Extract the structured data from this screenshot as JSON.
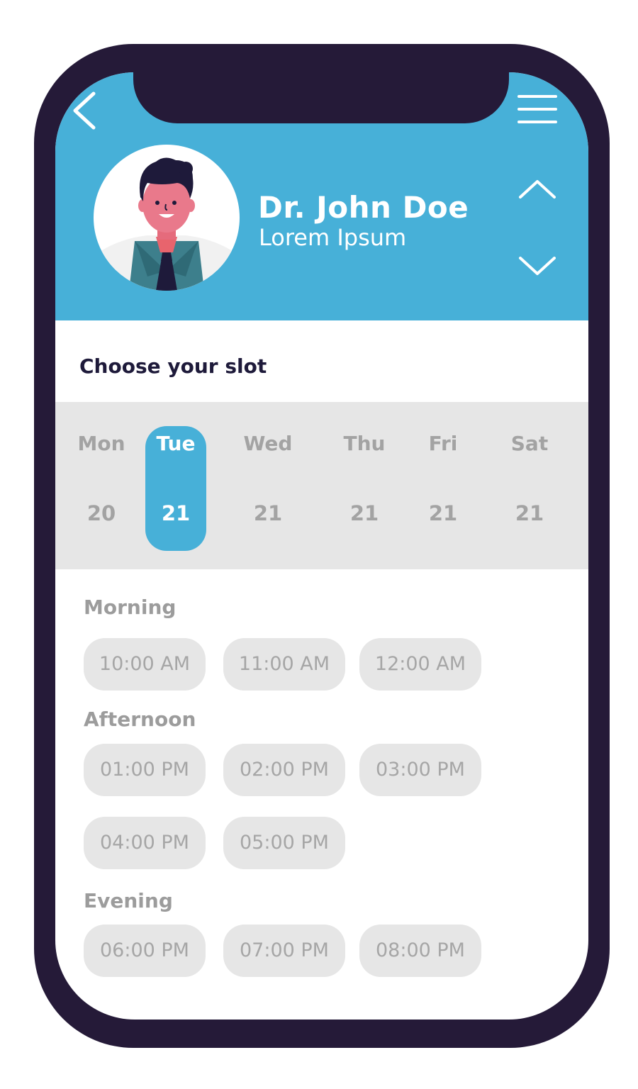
{
  "header": {
    "doctor_name": "Dr. John Doe",
    "doctor_subtitle": "Lorem Ipsum",
    "back_icon": "chevron-left-icon",
    "menu_icon": "hamburger-menu-icon",
    "up_icon": "chevron-up-icon",
    "down_icon": "chevron-down-icon",
    "color": "#47b0d8"
  },
  "slot_picker": {
    "title": "Choose your slot",
    "days": [
      {
        "name": "Mon",
        "date": "20",
        "selected": false
      },
      {
        "name": "Tue",
        "date": "21",
        "selected": true
      },
      {
        "name": "Wed",
        "date": "21",
        "selected": false
      },
      {
        "name": "Thu",
        "date": "21",
        "selected": false
      },
      {
        "name": "Fri",
        "date": "21",
        "selected": false
      },
      {
        "name": "Sat",
        "date": "21",
        "selected": false
      }
    ]
  },
  "sections": {
    "morning": {
      "label": "Morning",
      "slots": [
        "10:00 AM",
        "11:00 AM",
        "12:00 AM"
      ]
    },
    "afternoon": {
      "label": "Afternoon",
      "slots": [
        "01:00 PM",
        "02:00 PM",
        "03:00 PM",
        "04:00 PM",
        "05:00 PM"
      ]
    },
    "evening": {
      "label": "Evening",
      "slots": [
        "06:00 PM",
        "07:00 PM",
        "08:00 PM"
      ]
    }
  },
  "colors": {
    "accent": "#47b0d8",
    "phone_frame": "#251a38",
    "slot_bg": "#e6e6e6",
    "title_text": "#1e1a3a"
  }
}
